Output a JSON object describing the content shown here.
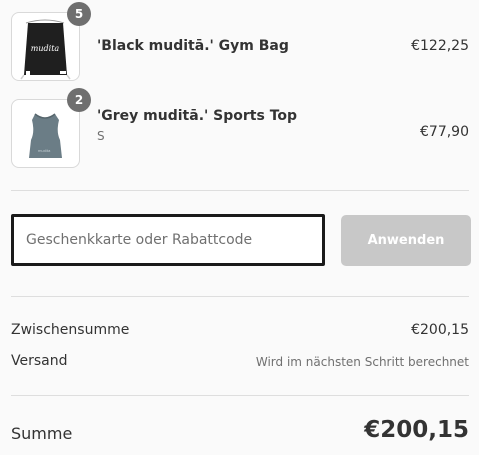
{
  "items": [
    {
      "name": "'Black muditā.' Gym Bag",
      "variant": "",
      "price": "€122,25",
      "quantity": "5",
      "image_icon": "black-gym-bag-image"
    },
    {
      "name": "'Grey muditā.' Sports Top",
      "variant": "S",
      "price": "€77,90",
      "quantity": "2",
      "image_icon": "grey-sports-top-image"
    }
  ],
  "discount": {
    "placeholder": "Geschenkkarte oder Rabattcode",
    "value": "",
    "apply_label": "Anwenden"
  },
  "summary": {
    "subtotal_label": "Zwischensumme",
    "subtotal_value": "€200,15",
    "shipping_label": "Versand",
    "shipping_value": "Wird im nächsten Schritt berechnet",
    "total_label": "Summe",
    "total_value": "€200,15"
  },
  "colors": {
    "badge": "#6f6f6f",
    "button_disabled": "#c8c8c8",
    "field_border": "#1a1a1a",
    "divider": "#dedede"
  }
}
